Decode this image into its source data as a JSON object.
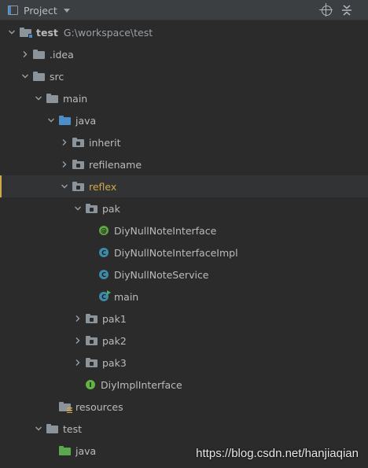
{
  "header": {
    "title": "Project",
    "icons": [
      "project-view-icon",
      "dropdown-caret-icon",
      "locate-target-icon",
      "collapse-all-icon"
    ]
  },
  "tree": {
    "project": {
      "name": "test",
      "path": "G:\\workspace\\test"
    },
    "idea": ".idea",
    "src": "src",
    "main": "main",
    "main_java": "java",
    "inherit": "inherit",
    "refilename": "refilename",
    "reflex": "reflex",
    "pak": "pak",
    "diy_null_note_interface": "DiyNullNoteInterface",
    "diy_null_note_interface_impl": "DiyNullNoteInterfaceImpl",
    "diy_null_note_service": "DiyNullNoteService",
    "main_class": "main",
    "pak1": "pak1",
    "pak2": "pak2",
    "pak3": "pak3",
    "diy_impl_interface": "DiyImplInterface",
    "resources": "resources",
    "test": "test",
    "test_java": "java",
    "class_badges": {
      "class": "C",
      "annotation": "@",
      "interface": "I"
    }
  },
  "colors": {
    "background": "#2b2b2b",
    "header": "#3c3f41",
    "selection_accent": "#d1a847",
    "source_folder": "#4c8ec8",
    "test_folder": "#5ca84f",
    "class_icon": "#3d8aaa"
  },
  "watermark": "https://blog.csdn.net/hanjiaqian"
}
